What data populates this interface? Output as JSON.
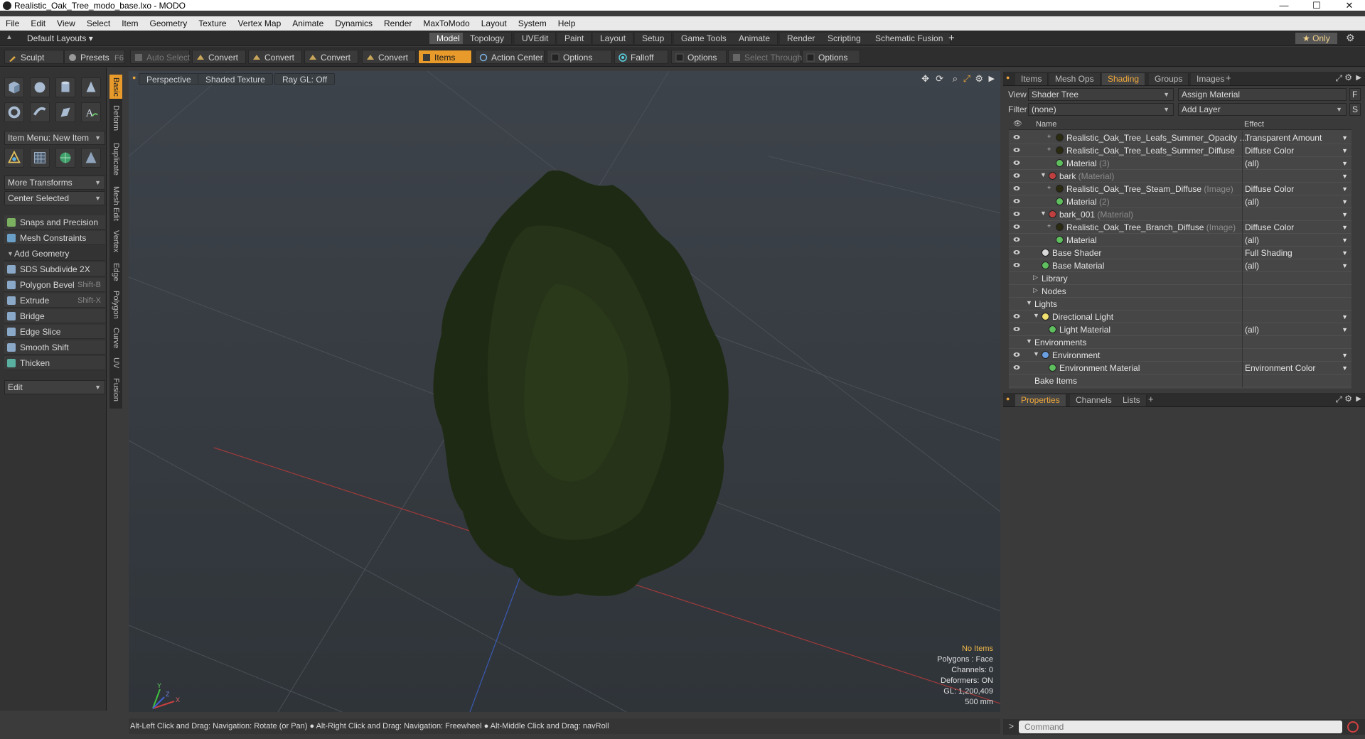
{
  "window": {
    "title": "Realistic_Oak_Tree_modo_base.lxo - MODO",
    "minimize": "—",
    "maximize": "☐",
    "close": "✕"
  },
  "menu": [
    "File",
    "Edit",
    "View",
    "Select",
    "Item",
    "Geometry",
    "Texture",
    "Vertex Map",
    "Animate",
    "Dynamics",
    "Render",
    "MaxToModo",
    "Layout",
    "System",
    "Help"
  ],
  "layoutbar": {
    "preset": "Default Layouts ▾",
    "tabs": [
      "Model",
      "Topology",
      "UVEdit",
      "Paint",
      "Layout",
      "Setup",
      "Game Tools",
      "Animate",
      "Render",
      "Scripting",
      "Schematic Fusion"
    ],
    "active_tab": "Model",
    "add": "+",
    "only": "★  Only"
  },
  "toolbar": {
    "sculpt": "Sculpt",
    "presets": "Presets",
    "presets_key": "F6",
    "auto_select": "Auto Select",
    "convert1": "Convert",
    "convert2": "Convert",
    "convert3": "Convert",
    "convert4": "Convert",
    "items": "Items",
    "action_center": "Action Center",
    "options1": "Options",
    "falloff": "Falloff",
    "options2": "Options",
    "select_through": "Select Through",
    "options3": "Options"
  },
  "left": {
    "item_menu": "Item Menu: New Item",
    "more_transforms": "More Transforms",
    "center_selected": "Center Selected",
    "snaps": "Snaps and Precision",
    "mesh_constraints": "Mesh Constraints",
    "add_geometry": "Add Geometry",
    "tools": [
      {
        "label": "SDS Subdivide 2X",
        "key": ""
      },
      {
        "label": "Polygon Bevel",
        "key": "Shift-B"
      },
      {
        "label": "Extrude",
        "key": "Shift-X"
      },
      {
        "label": "Bridge",
        "key": ""
      },
      {
        "label": "Edge Slice",
        "key": ""
      },
      {
        "label": "Smooth Shift",
        "key": ""
      },
      {
        "label": "Thicken",
        "key": ""
      }
    ],
    "edit": "Edit",
    "vtabs": [
      "Basic",
      "Deform",
      "Duplicate",
      "Mesh Edit",
      "Vertex",
      "Edge",
      "Polygon",
      "Curve",
      "UV",
      "Fusion"
    ]
  },
  "viewport": {
    "perspective": "Perspective",
    "shading": "Shaded Texture",
    "raygl": "Ray GL: Off",
    "info": {
      "no_items": "No Items",
      "polygons": "Polygons : Face",
      "channels": "Channels: 0",
      "deformers": "Deformers: ON",
      "gl": "GL: 1,200,409",
      "scale": "500 mm"
    },
    "axis": {
      "x": "X",
      "y": "Y",
      "z": "Z"
    }
  },
  "status": "Alt-Left Click and Drag: Navigation: Rotate (or Pan) ● Alt-Right Click and Drag: Navigation: Freewheel ● Alt-Middle Click and Drag: navRoll",
  "right": {
    "tabs": [
      "Items",
      "Mesh Ops",
      "Shading",
      "Groups",
      "Images"
    ],
    "active_tab": "Shading",
    "add": "+",
    "view_label": "View",
    "view_value": "Shader Tree",
    "assign_material": "Assign Material",
    "f_button": "F",
    "filter_label": "Filter",
    "filter_value": "(none)",
    "add_layer": "Add Layer",
    "s_button": "S",
    "col_name": "Name",
    "col_effect": "Effect",
    "rows": [
      {
        "name": "Realistic_Oak_Tree_Leafs_Summer_Opacity ...",
        "sub": "",
        "effect": "Transparent Amount",
        "indent": 4,
        "ball": "#2a2a10",
        "exp": "+"
      },
      {
        "name": "Realistic_Oak_Tree_Leafs_Summer_Diffuse",
        "sub": "",
        "effect": "Diffuse Color",
        "indent": 4,
        "ball": "#2a2a10",
        "exp": "+"
      },
      {
        "name": "Material",
        "sub": " (3)",
        "effect": "(all)",
        "indent": 4,
        "ball": "#5fbf5f",
        "exp": ""
      },
      {
        "name": "bark",
        "sub": " (Material)",
        "effect": "",
        "indent": 3,
        "ball": "#c04040",
        "exp": "▼"
      },
      {
        "name": "Realistic_Oak_Tree_Steam_Diffuse",
        "sub": " (Image)",
        "effect": "Diffuse Color",
        "indent": 4,
        "ball": "#2a2a10",
        "exp": "+"
      },
      {
        "name": "Material",
        "sub": " (2)",
        "effect": "(all)",
        "indent": 4,
        "ball": "#5fbf5f",
        "exp": ""
      },
      {
        "name": "bark_001",
        "sub": " (Material)",
        "effect": "",
        "indent": 3,
        "ball": "#c04040",
        "exp": "▼"
      },
      {
        "name": "Realistic_Oak_Tree_Branch_Diffuse",
        "sub": " (Image)",
        "effect": "Diffuse Color",
        "indent": 4,
        "ball": "#2a2a10",
        "exp": "+"
      },
      {
        "name": "Material",
        "sub": "",
        "effect": "(all)",
        "indent": 4,
        "ball": "#5fbf5f",
        "exp": ""
      },
      {
        "name": "Base Shader",
        "sub": "",
        "effect": "Full Shading",
        "indent": 2,
        "ball": "#d8d8d8",
        "exp": ""
      },
      {
        "name": "Base Material",
        "sub": "",
        "effect": "(all)",
        "indent": 2,
        "ball": "#5fbf5f",
        "exp": ""
      },
      {
        "name": "Library",
        "sub": "",
        "effect": "",
        "indent": 2,
        "ball": "",
        "exp": "▷"
      },
      {
        "name": "Nodes",
        "sub": "",
        "effect": "",
        "indent": 2,
        "ball": "",
        "exp": "▷"
      },
      {
        "name": "Lights",
        "sub": "",
        "effect": "",
        "indent": 1,
        "ball": "",
        "exp": "▼"
      },
      {
        "name": "Directional Light",
        "sub": "",
        "effect": "",
        "indent": 2,
        "ball": "#f0e070",
        "exp": "▼"
      },
      {
        "name": "Light Material",
        "sub": "",
        "effect": "(all)",
        "indent": 3,
        "ball": "#5fbf5f",
        "exp": ""
      },
      {
        "name": "Environments",
        "sub": "",
        "effect": "",
        "indent": 1,
        "ball": "",
        "exp": "▼"
      },
      {
        "name": "Environment",
        "sub": "",
        "effect": "",
        "indent": 2,
        "ball": "#6aa0e0",
        "exp": "▼"
      },
      {
        "name": "Environment Material",
        "sub": "",
        "effect": "Environment Color",
        "indent": 3,
        "ball": "#5fbf5f",
        "exp": ""
      },
      {
        "name": "Bake Items",
        "sub": "",
        "effect": "",
        "indent": 1,
        "ball": "",
        "exp": ""
      }
    ],
    "props_tabs": [
      "Properties",
      "Channels",
      "Lists"
    ],
    "props_active": "Properties",
    "command_placeholder": "Command"
  },
  "colors": {
    "accent": "#e89a2a",
    "tree_dark": "#1f2a14",
    "grid_red": "#b23a3a",
    "grid_blue": "#3a5ab2"
  }
}
